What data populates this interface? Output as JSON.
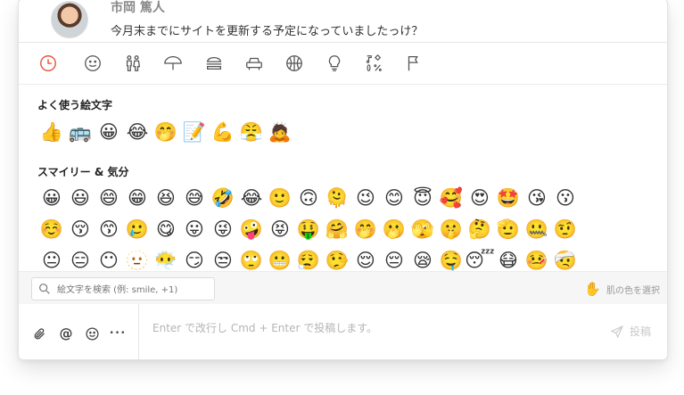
{
  "message": {
    "author": "市岡 篤人",
    "text": "今月末までにサイトを更新する予定になっていましたっけ？"
  },
  "picker": {
    "categories": [
      {
        "name": "clock-icon",
        "active": true
      },
      {
        "name": "smiley-icon"
      },
      {
        "name": "people-icon"
      },
      {
        "name": "umbrella-icon"
      },
      {
        "name": "burger-icon"
      },
      {
        "name": "car-icon"
      },
      {
        "name": "ball-icon"
      },
      {
        "name": "lightbulb-icon"
      },
      {
        "name": "symbols-icon"
      },
      {
        "name": "flag-icon"
      }
    ],
    "frequent_title": "よく使う絵文字",
    "frequent": [
      "👍",
      "🚌",
      "😀",
      "😂",
      "🤭",
      "📝",
      "💪",
      "😤",
      "🙇"
    ],
    "smileys_title": "スマイリー & 気分",
    "smileys_rows": [
      [
        "😀",
        "😃",
        "😄",
        "😁",
        "😆",
        "😅",
        "🤣",
        "😂",
        "🙂",
        "🙃",
        "🫠",
        "😉",
        "😊",
        "😇",
        "🥰",
        "😍",
        "🤩",
        "😘",
        "😗"
      ],
      [
        "☺️",
        "😚",
        "😙",
        "🥲",
        "😋",
        "😛",
        "😜",
        "🤪",
        "😝",
        "🤑",
        "🤗",
        "🤭",
        "🫢",
        "🫣",
        "🤫",
        "🤔",
        "🫡",
        "🤐",
        "🤨"
      ],
      [
        "😐",
        "😑",
        "😶",
        "🫥",
        "😶‍🌫️",
        "😏",
        "😒",
        "🙄",
        "😬",
        "😮‍💨",
        "🤥",
        "😌",
        "😔",
        "😪",
        "🤤",
        "😴",
        "😷",
        "🤒",
        "🤕"
      ]
    ],
    "search_placeholder": "絵文字を検索 (例: smile, +1)",
    "skin_hand": "✋",
    "skin_label": "肌の色を選択"
  },
  "composer": {
    "placeholder": "Enter で改行し Cmd + Enter で投稿します。",
    "post_label": "投稿",
    "tools": [
      "paperclip-icon",
      "at-icon",
      "emoji-icon",
      "more-icon"
    ],
    "at_symbol": "@",
    "more_symbol": "•••"
  },
  "colors": {
    "accent": "#e8563f",
    "icon": "#555555"
  }
}
